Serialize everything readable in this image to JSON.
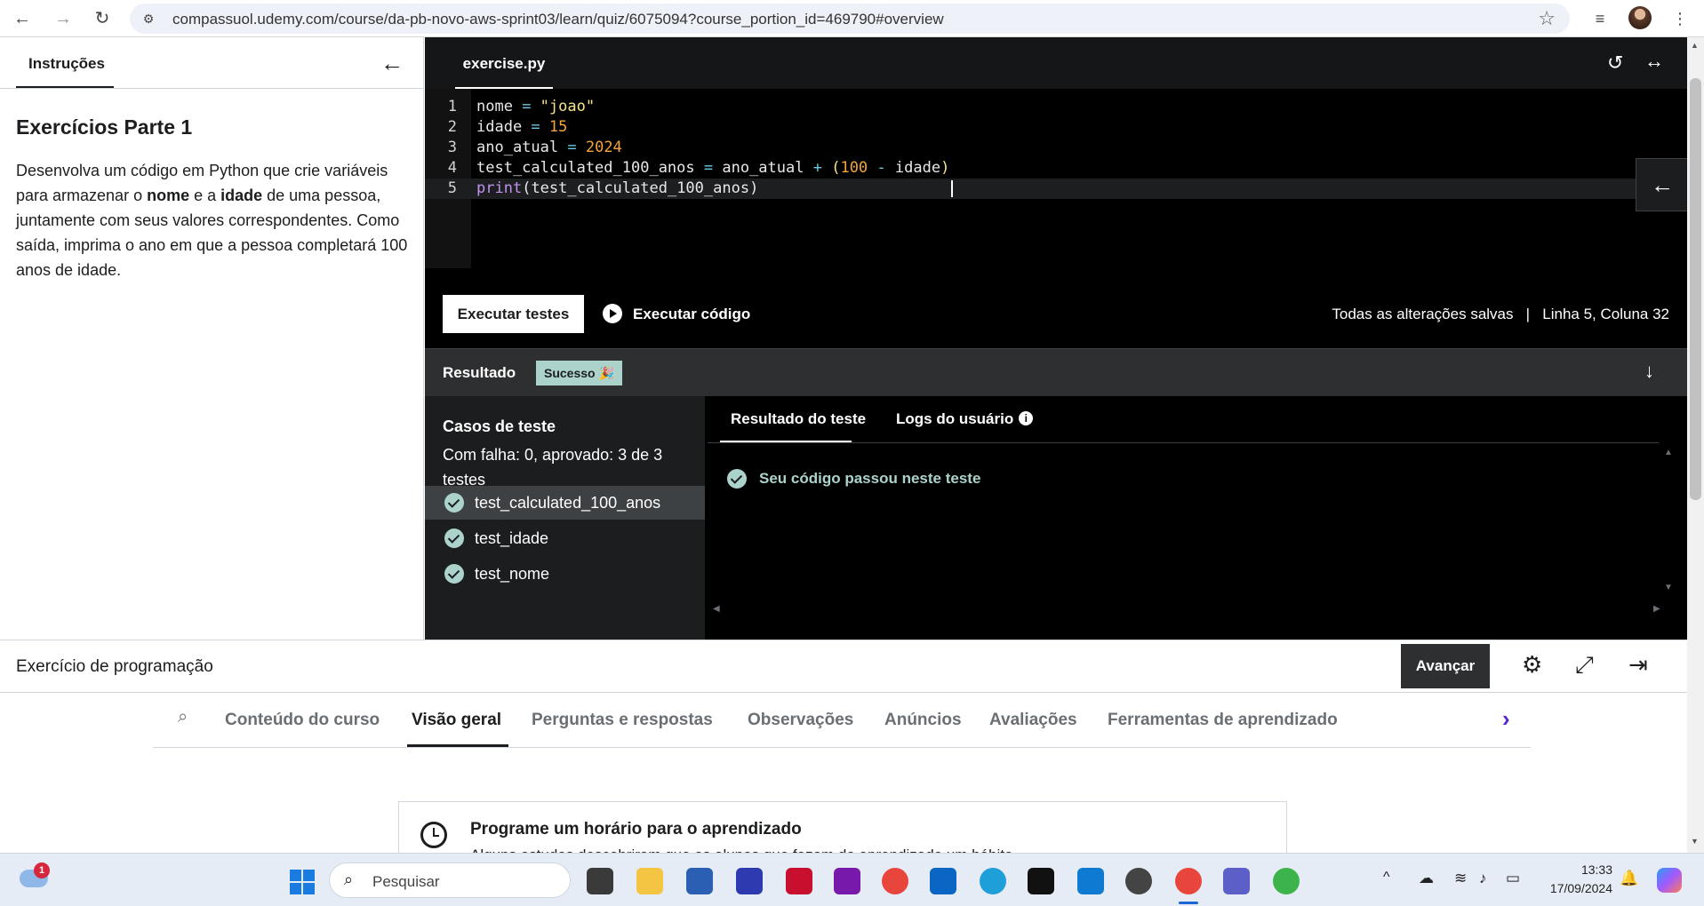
{
  "browser": {
    "url": "compassuol.udemy.com/course/da-pb-novo-aws-sprint03/learn/quiz/6075094?course_portion_id=469790#overview"
  },
  "instructions": {
    "tab_label": "Instruções",
    "title": "Exercícios Parte 1",
    "body": {
      "p1": "Desenvolva um código em Python que crie variáveis para armazenar o ",
      "b1": "nome",
      "p2": " e a ",
      "b2": "idade",
      "p3": " de uma pessoa, juntamente com seus valores correspondentes. Como saída, imprima o ano em que a pessoa completará 100 anos de idade."
    }
  },
  "editor": {
    "file_tab": "exercise.py",
    "lines": [
      {
        "num": "1",
        "tokens": [
          "nome",
          " = ",
          "\"joao\""
        ]
      },
      {
        "num": "2",
        "tokens": [
          "idade",
          " = ",
          "15"
        ]
      },
      {
        "num": "3",
        "tokens": [
          "ano_atual",
          " = ",
          "2024"
        ]
      },
      {
        "num": "4",
        "tokens": [
          "test_calculated_100_anos",
          " = ",
          "ano_atual",
          " + ",
          "(",
          "100",
          " - ",
          "idade",
          ")"
        ]
      },
      {
        "num": "5",
        "tokens": [
          "print",
          "(",
          "test_calculated_100_anos",
          ")"
        ]
      }
    ],
    "run_tests_label": "Executar testes",
    "run_code_label": "Executar código",
    "save_status": "Todas as alterações salvas",
    "separator": "|",
    "cursor_position": "Linha 5, Coluna 32"
  },
  "result": {
    "label": "Resultado",
    "badge": "Sucesso 🎉",
    "cases_title": "Casos de teste",
    "cases_summary": "Com falha: 0, aprovado: 3 de 3 testes",
    "cases": [
      "test_calculated_100_anos",
      "test_idade",
      "test_nome"
    ],
    "tab_result": "Resultado do teste",
    "tab_logs": "Logs do usuário",
    "info_glyph": "i",
    "pass_message": "Seu código passou neste teste"
  },
  "footer": {
    "exercise_label": "Exercício de programação",
    "next_button": "Avançar"
  },
  "course_nav": {
    "tabs": [
      "Conteúdo do curso",
      "Visão geral",
      "Perguntas e respostas",
      "Observações",
      "Anúncios",
      "Avaliações",
      "Ferramentas de aprendizado"
    ],
    "active_tab": "Visão geral"
  },
  "schedule": {
    "title": "Programe um horário para o aprendizado",
    "text": "Alguns estudos descobriram que os alunos que fazem do aprendizado um hábito"
  },
  "taskbar": {
    "weather_badge": "1",
    "search_placeholder": "Pesquisar",
    "time": "13:33",
    "date": "17/09/2024"
  },
  "colors": {
    "success": "#acd2cc",
    "accent_purple": "#5624d0",
    "editor_bg": "#000000"
  }
}
